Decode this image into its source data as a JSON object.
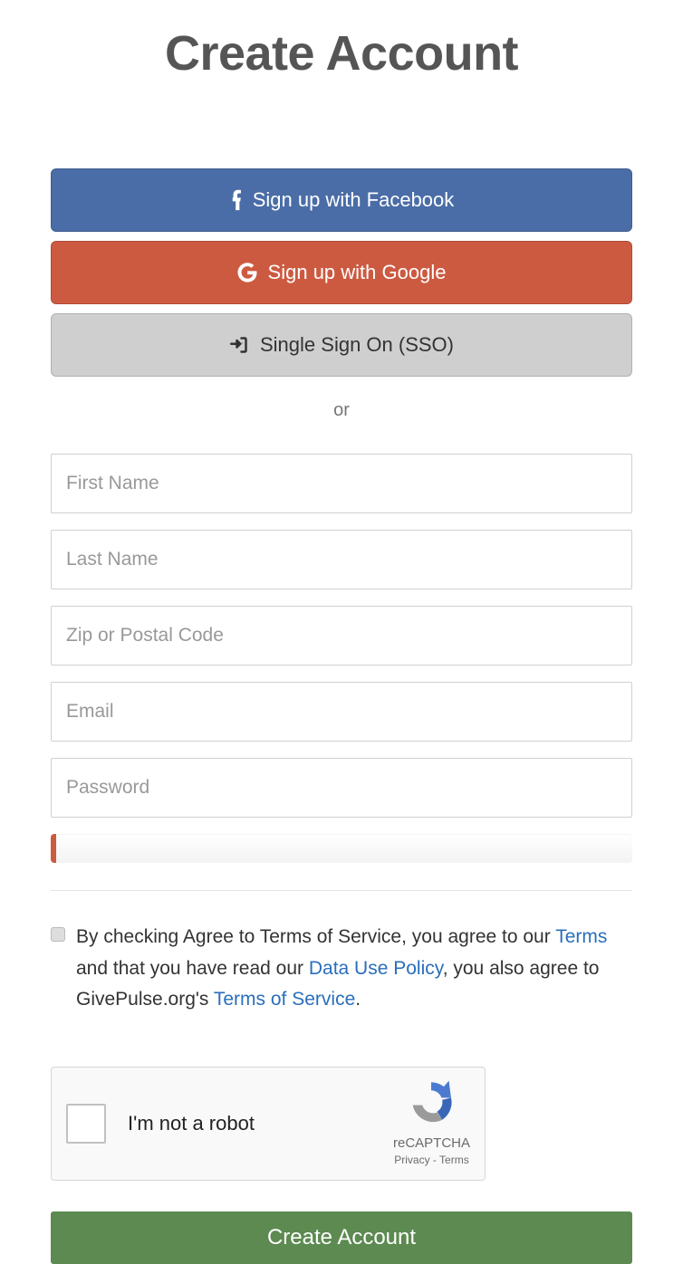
{
  "page": {
    "title": "Create Account"
  },
  "social": {
    "facebook_label": "Sign up with Facebook",
    "google_label": "Sign up with Google",
    "sso_label": "Single Sign On (SSO)"
  },
  "divider": {
    "or_text": "or"
  },
  "form": {
    "first_name": {
      "placeholder": "First Name",
      "value": ""
    },
    "last_name": {
      "placeholder": "Last Name",
      "value": ""
    },
    "zip": {
      "placeholder": "Zip or Postal Code",
      "value": ""
    },
    "email": {
      "placeholder": "Email",
      "value": ""
    },
    "password": {
      "placeholder": "Password",
      "value": ""
    }
  },
  "terms": {
    "prefix": "By checking Agree to Terms of Service, you agree to our ",
    "link1": "Terms",
    "mid1": " and that you have read our ",
    "link2": "Data Use Policy",
    "mid2": ", you also agree to GivePulse.org's ",
    "link3": "Terms of Service",
    "suffix": "."
  },
  "recaptcha": {
    "label": "I'm not a robot",
    "brand": "reCAPTCHA",
    "privacy": "Privacy",
    "terms": "Terms",
    "separator": " - "
  },
  "submit": {
    "label": "Create Account"
  }
}
